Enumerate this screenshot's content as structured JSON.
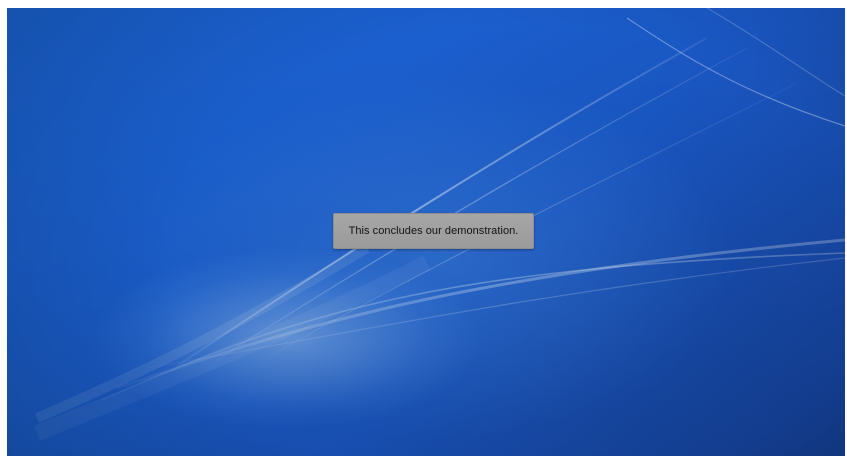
{
  "desktop": {
    "wallpaper": "blue-light-streaks",
    "colors": {
      "base": "#1a5fcf",
      "dark": "#143e93",
      "streak": "#bfe3ff"
    }
  },
  "notification": {
    "message": "This concludes our demonstration."
  }
}
